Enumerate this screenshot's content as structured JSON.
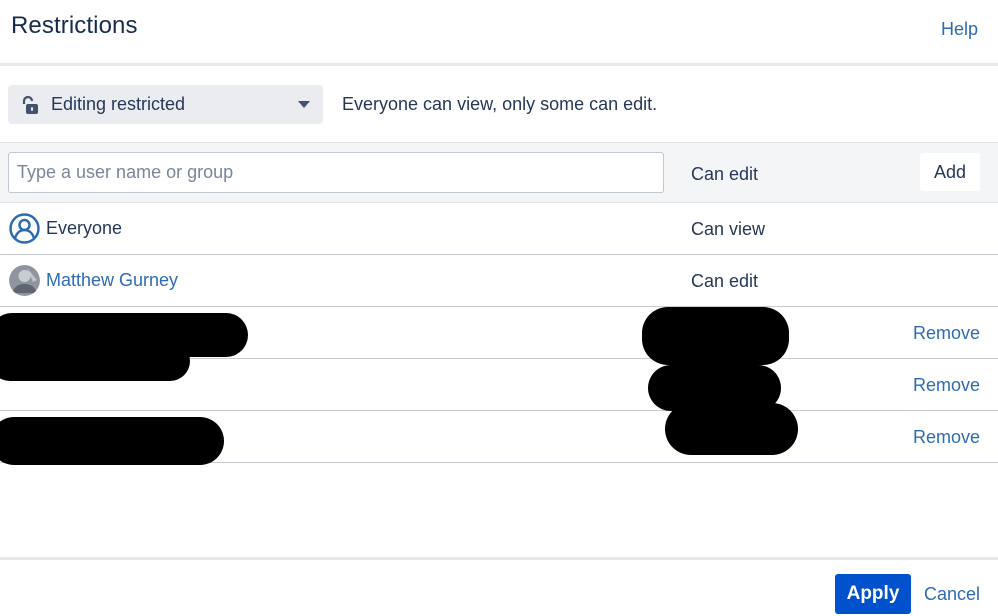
{
  "dialog": {
    "title": "Restrictions",
    "help_label": "Help"
  },
  "mode": {
    "selected": "Editing restricted",
    "description": "Everyone can view, only some can edit."
  },
  "add_row": {
    "placeholder": "Type a user name or group",
    "permission": "Can edit",
    "add_label": "Add"
  },
  "entries": [
    {
      "name": "Everyone",
      "permission": "Can view",
      "icon": "group-icon"
    },
    {
      "name": "Matthew Gurney",
      "permission": "Can edit",
      "icon": "user-avatar"
    },
    {
      "remove_label": "Remove",
      "redacted": true
    },
    {
      "remove_label": "Remove",
      "redacted": true
    },
    {
      "remove_label": "Remove",
      "redacted": true
    }
  ],
  "footer": {
    "apply_label": "Apply",
    "cancel_label": "Cancel"
  },
  "colors": {
    "primary": "#0052cc",
    "link": "#2e6bb3",
    "text": "#253858",
    "row_bg": "#f4f5f7",
    "select_bg": "#ebecf0"
  }
}
